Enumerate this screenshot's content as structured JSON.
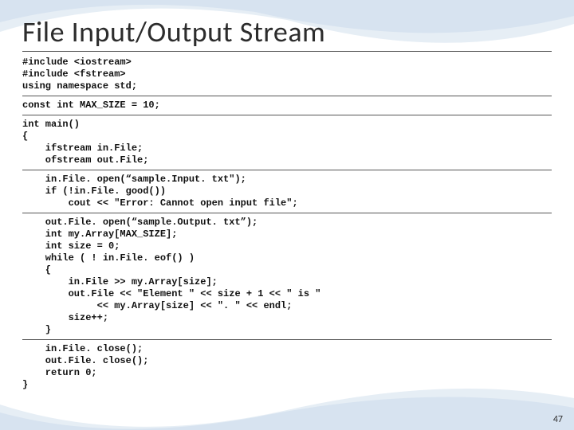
{
  "title": "File Input/Output Stream",
  "code": {
    "block1": "#include <iostream>\n#include <fstream>\nusing namespace std;",
    "block2": "const int MAX_SIZE = 10;",
    "block3": "int main()\n{\n    ifstream in.File;\n    ofstream out.File;",
    "block4": "    in.File. open(“sample.Input. txt\");\n    if (!in.File. good())\n        cout << \"Error: Cannot open input file\";",
    "block5": "    out.File. open(“sample.Output. txt”);\n    int my.Array[MAX_SIZE];\n    int size = 0;\n    while ( ! in.File. eof() )\n    {\n        in.File >> my.Array[size];\n        out.File << \"Element \" << size + 1 << \" is \"\n             << my.Array[size] << \". \" << endl;\n        size++;\n    }",
    "block6": "    in.File. close();\n    out.File. close();\n    return 0;\n}"
  },
  "page_number": "47",
  "colors": {
    "wave1": "#e6eef5",
    "wave2": "#d4e1ee",
    "wave3": "#c9dae9"
  }
}
